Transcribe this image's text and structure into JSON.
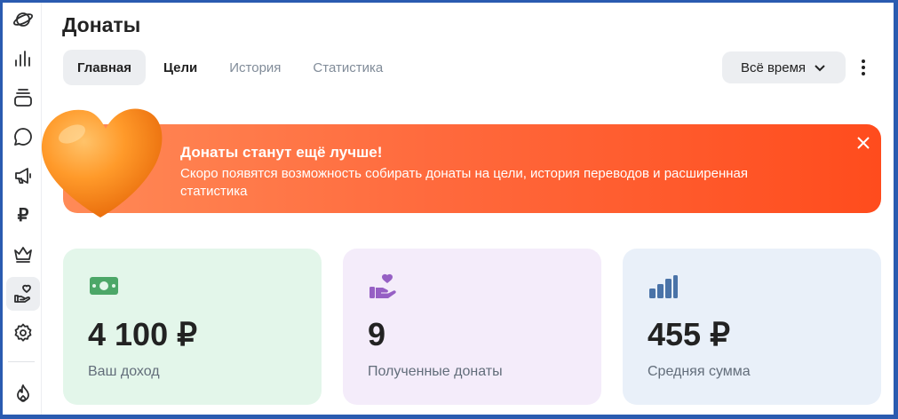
{
  "page": {
    "title": "Донаты"
  },
  "tabs": [
    {
      "label": "Главная"
    },
    {
      "label": "Цели"
    },
    {
      "label": "История"
    },
    {
      "label": "Статистика"
    }
  ],
  "period": {
    "label": "Всё время"
  },
  "banner": {
    "title": "Донаты станут ещё лучше!",
    "text": "Скоро появятся возможность собирать донаты на цели, история переводов и расширенная статистика"
  },
  "sidebar": {
    "ruble_symbol": "₽",
    "items": [
      {
        "icon": "planet-icon"
      },
      {
        "icon": "stats-icon"
      },
      {
        "icon": "stack-icon"
      },
      {
        "icon": "chat-icon"
      },
      {
        "icon": "megaphone-icon"
      },
      {
        "icon": "ruble-icon"
      },
      {
        "icon": "crown-icon"
      },
      {
        "icon": "donate-hand-icon",
        "active": true
      },
      {
        "icon": "gear-icon"
      },
      {
        "icon": "fire-icon"
      }
    ]
  },
  "cards": [
    {
      "value": "4 100 ₽",
      "label": "Ваш доход",
      "icon": "money-icon",
      "color": "#4ca768"
    },
    {
      "value": "9",
      "label": "Полученные донаты",
      "icon": "hand-heart-icon",
      "color": "#9660c4"
    },
    {
      "value": "455 ₽",
      "label": "Средняя сумма",
      "icon": "bar-chart-icon",
      "color": "#4a73a8"
    }
  ],
  "colors": {
    "banner_start": "#ff8a57",
    "banner_end": "#ff4c1d",
    "heart": "#ff8c1a"
  }
}
